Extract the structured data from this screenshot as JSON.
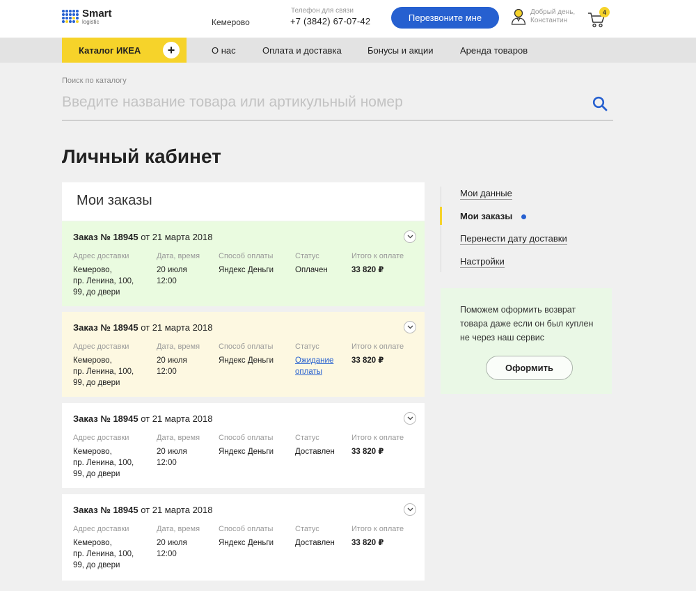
{
  "header": {
    "logo_main": "Smart",
    "logo_sub": "logistic",
    "city": "Кемерово",
    "phone_label": "Телефон для связи",
    "phone": "+7 (3842) 67-07-42",
    "callback_label": "Перезвоните мне",
    "greeting_line1": "Добрый день,",
    "greeting_line2": "Константин",
    "cart_count": "4",
    "accent_color": "#f6d32a",
    "brand_blue": "#2660d0"
  },
  "nav": {
    "catalog_label": "Каталог ИКЕА",
    "links": [
      "О нас",
      "Оплата и доставка",
      "Бонусы и акции",
      "Аренда товаров"
    ]
  },
  "search": {
    "label": "Поиск по каталогу",
    "placeholder": "Введите название товара или артикульный номер",
    "value": ""
  },
  "page_title": "Личный кабинет",
  "orders": {
    "title": "Мои заказы",
    "labels": {
      "address": "Адрес доставки",
      "datetime": "Дата, время",
      "payment": "Способ оплаты",
      "status": "Статус",
      "total": "Итого к оплате"
    },
    "items": [
      {
        "number_label": "Заказ № 18945",
        "date_label": " от 21 марта 2018",
        "address": [
          "Кемерово,",
          "пр. Ленина, 100,",
          "99, до двери"
        ],
        "date": [
          "20 июля",
          "12:00"
        ],
        "payment": "Яндекс Деньги",
        "status": [
          "Оплачен"
        ],
        "total": "33 820 ₽",
        "bg": "#eafbe0"
      },
      {
        "number_label": "Заказ № 18945",
        "date_label": " от 21 марта 2018",
        "address": [
          "Кемерово,",
          "пр. Ленина, 100,",
          "99, до двери"
        ],
        "date": [
          "20 июля",
          "12:00"
        ],
        "payment": "Яндекс Деньги",
        "status": [
          "Ожидание",
          "оплаты"
        ],
        "total": "33 820 ₽",
        "bg": "#fdf8e1"
      },
      {
        "number_label": "Заказ № 18945",
        "date_label": " от 21 марта 2018",
        "address": [
          "Кемерово,",
          "пр. Ленина, 100,",
          "99, до двери"
        ],
        "date": [
          "20 июля",
          "12:00"
        ],
        "payment": "Яндекс Деньги",
        "status": [
          "Доставлен"
        ],
        "total": "33 820 ₽",
        "bg": "#ffffff"
      },
      {
        "number_label": "Заказ № 18945",
        "date_label": " от 21 марта 2018",
        "address": [
          "Кемерово,",
          "пр. Ленина, 100,",
          "99, до двери"
        ],
        "date": [
          "20 июля",
          "12:00"
        ],
        "payment": "Яндекс Деньги",
        "status": [
          "Доставлен"
        ],
        "total": "33 820 ₽",
        "bg": "#ffffff"
      }
    ]
  },
  "menu": {
    "items": [
      {
        "label": "Мои данные"
      },
      {
        "label": "Мои заказы"
      },
      {
        "label": "Перенести дату доставки"
      },
      {
        "label": "Настройки"
      }
    ]
  },
  "return": {
    "text": "Поможем оформить возврат товара даже если он был куплен не через наш сервис",
    "button_label": "Оформить"
  }
}
